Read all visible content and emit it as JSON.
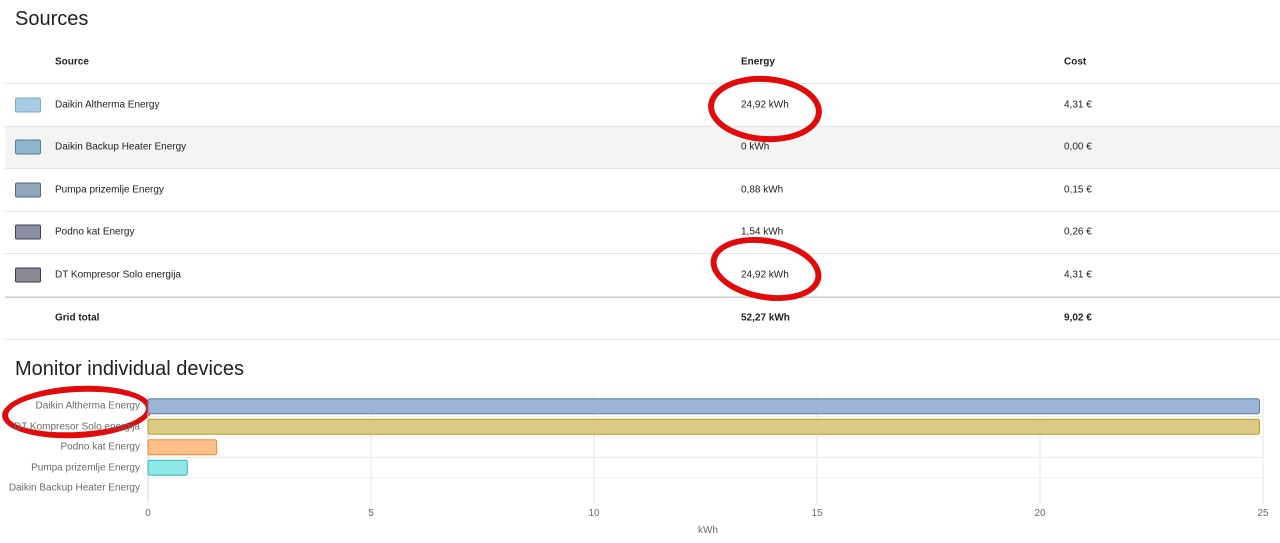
{
  "sources": {
    "title": "Sources",
    "headers": {
      "source": "Source",
      "energy": "Energy",
      "cost": "Cost"
    },
    "rows": [
      {
        "name": "Daikin Altherma Energy",
        "energy": "24,92 kWh",
        "cost": "4,31 €",
        "color": "#a9cce6",
        "border": "#7fa8c6"
      },
      {
        "name": "Daikin Backup Heater Energy",
        "energy": "0 kWh",
        "cost": "0,00 €",
        "color": "#8db5cc",
        "border": "#4f7f98"
      },
      {
        "name": "Pumpa prizemlje Energy",
        "energy": "0,88 kWh",
        "cost": "0,15 €",
        "color": "#8ea6b8",
        "border": "#4d6a80"
      },
      {
        "name": "Podno kat Energy",
        "energy": "1,54 kWh",
        "cost": "0,26 €",
        "color": "#8c90a4",
        "border": "#3d4258"
      },
      {
        "name": "DT Kompresor Solo energija",
        "energy": "24,92 kWh",
        "cost": "4,31 €",
        "color": "#8c8a96",
        "border": "#3a3846"
      }
    ],
    "total": {
      "label": "Grid total",
      "energy": "52,27 kWh",
      "cost": "9,02 €"
    }
  },
  "monitor": {
    "title": "Monitor individual devices"
  },
  "chart_data": {
    "type": "bar",
    "orientation": "horizontal",
    "categories": [
      "Daikin Altherma Energy",
      "DT Kompresor Solo energija",
      "Podno kat Energy",
      "Pumpa prizemlje Energy",
      "Daikin Backup Heater Energy"
    ],
    "values": [
      24.92,
      24.92,
      1.54,
      0.88,
      0
    ],
    "colors": [
      "#9db4d4",
      "#dccb84",
      "#fbbf87",
      "#8ee8e8",
      "#cccccc"
    ],
    "borders": [
      "#5a7fa8",
      "#b89a1e",
      "#e08a3c",
      "#2fb5b5",
      "#999999"
    ],
    "xlim": [
      0,
      25
    ],
    "xticks": [
      "0",
      "5",
      "10",
      "15",
      "20",
      "25"
    ],
    "xlabel": "kWh",
    "ylabel": "",
    "grid": true
  }
}
